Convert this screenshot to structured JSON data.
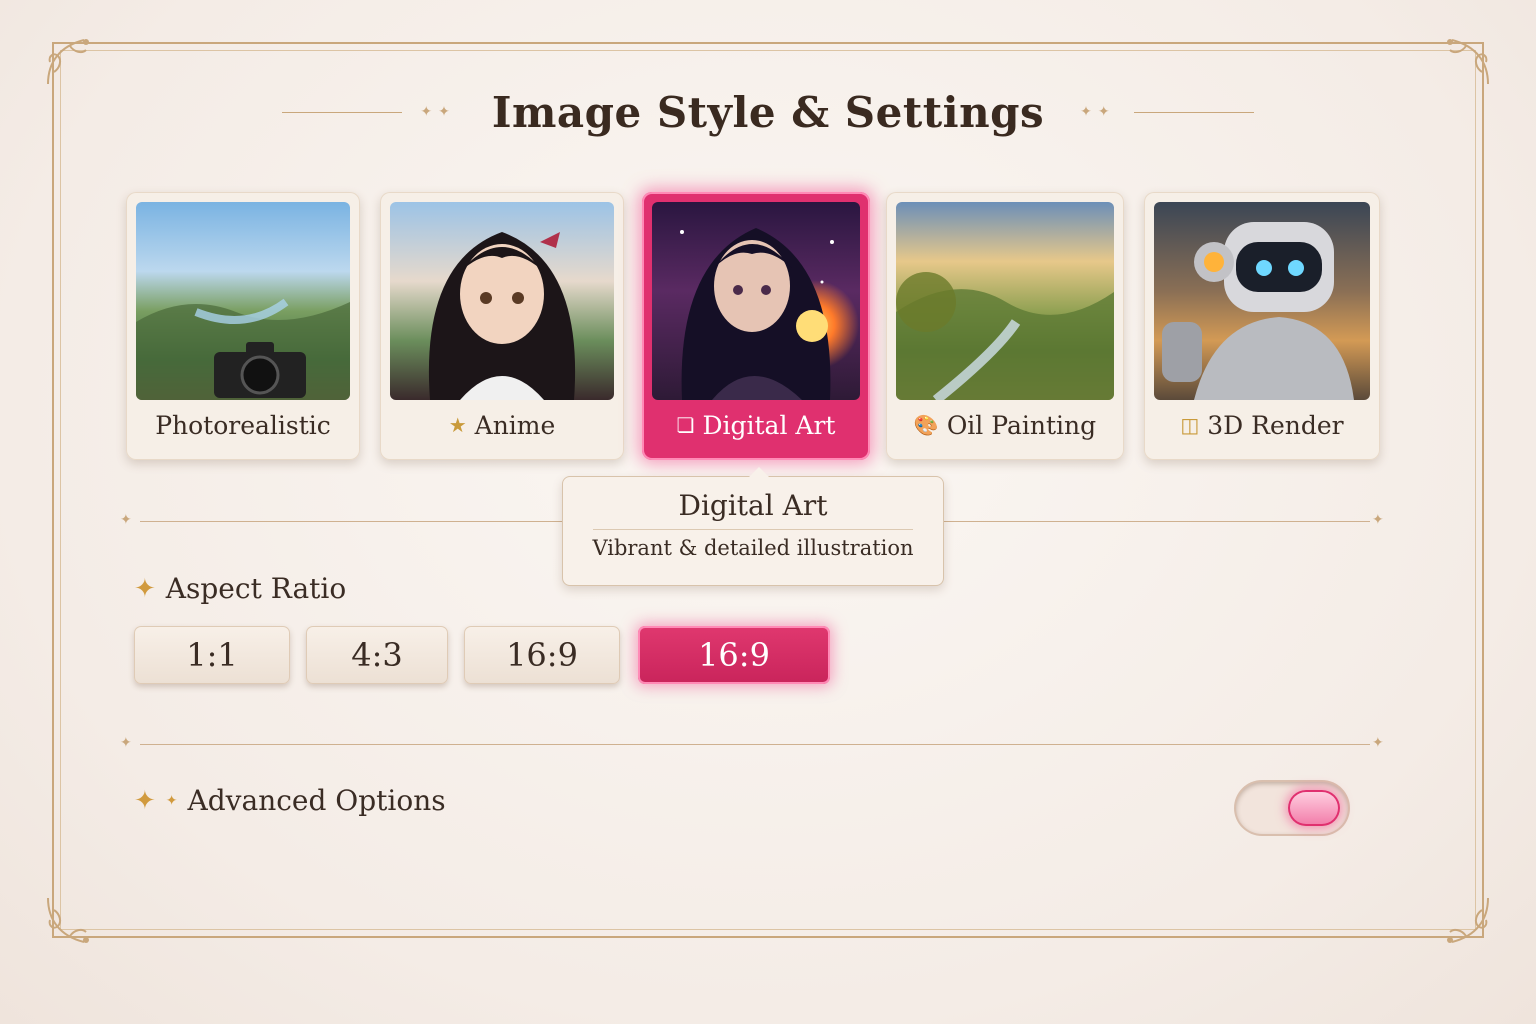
{
  "header": {
    "title": "Image Style & Settings"
  },
  "styles": {
    "selected": "Digital Art",
    "cards": [
      {
        "label": "Photorealistic",
        "icon": "camera-icon",
        "glyph": ""
      },
      {
        "label": "Anime",
        "icon": "star-icon",
        "glyph": "★"
      },
      {
        "label": "Digital Art",
        "icon": "tablet-icon",
        "glyph": "❏"
      },
      {
        "label": "Oil Painting",
        "icon": "palette-icon",
        "glyph": "🎨"
      },
      {
        "label": "3D Render",
        "icon": "cube-icon",
        "glyph": "◫"
      }
    ]
  },
  "tooltip": {
    "title": "Digital Art",
    "description": "Vibrant & detailed illustration"
  },
  "aspect_ratio": {
    "label": "Aspect Ratio",
    "options": [
      "1:1",
      "4:3",
      "16:9",
      "16:9"
    ],
    "selected_index": 3
  },
  "advanced": {
    "label": "Advanced Options",
    "enabled": true
  },
  "colors": {
    "accent": "#e0306f",
    "gold": "#c9a77c",
    "background": "#f6efe7"
  }
}
